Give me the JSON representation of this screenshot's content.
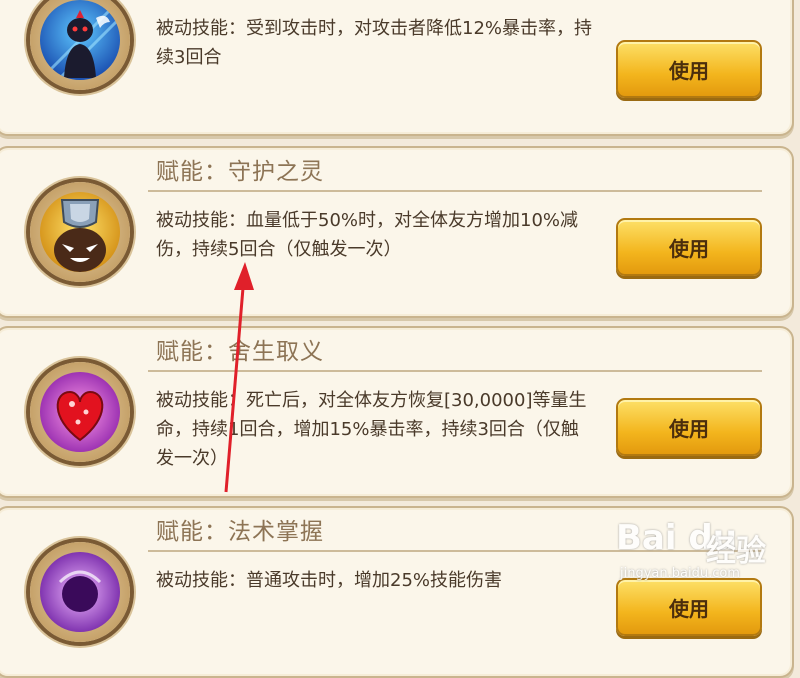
{
  "skills": [
    {
      "title": "",
      "description": "被动技能：受到攻击时，对攻击者降低12%暴击率，持续3回合",
      "button_label": "使用",
      "icon": "shadow-fighter-icon"
    },
    {
      "title": "赋能：守护之灵",
      "description": "被动技能：血量低于50%时，对全体友方增加10%减伤，持续5回合（仅触发一次）",
      "button_label": "使用",
      "icon": "guardian-shield-icon"
    },
    {
      "title": "赋能：舍生取义",
      "description": "被动技能：死亡后，对全体友方恢复[30,0000]等量生命，持续1回合，增加15%暴击率，持续3回合（仅触发一次）",
      "button_label": "使用",
      "icon": "heart-icon"
    },
    {
      "title": "赋能：法术掌握",
      "description": "被动技能：普通攻击时，增加25%技能伤害",
      "button_label": "使用",
      "icon": "arcane-orb-icon"
    }
  ],
  "watermark": {
    "logo": "Bai du",
    "brand": "经验",
    "url": "jingyan.baidu.com"
  },
  "colors": {
    "card_bg": "#fbf6ea",
    "title_text": "#8d7455",
    "desc_text": "#4a3a2a",
    "button_gold": "#f3b51d",
    "arrow_red": "#e0202a"
  }
}
